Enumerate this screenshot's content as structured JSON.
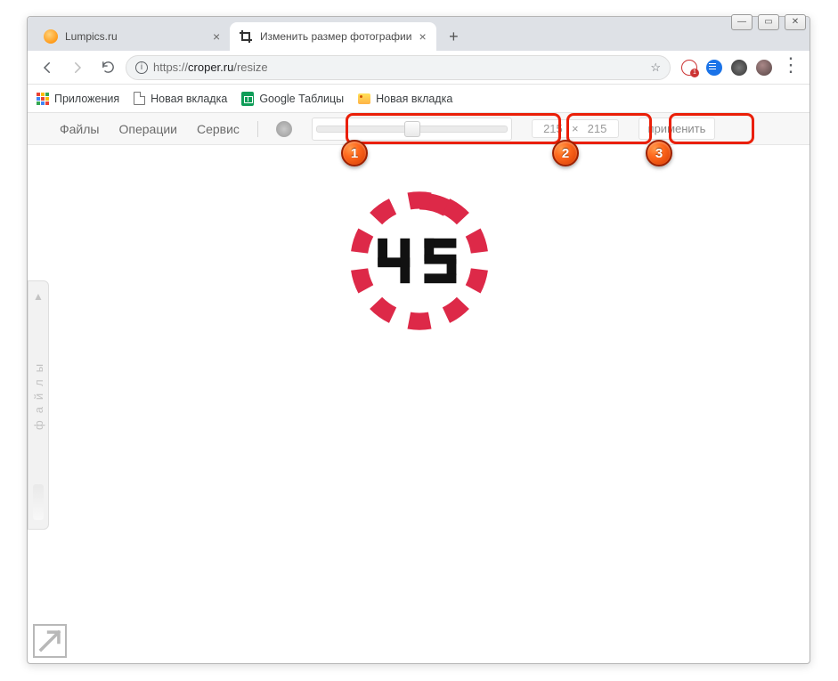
{
  "window": {
    "minimize": "—",
    "maximize": "▭",
    "close": "✕"
  },
  "tabs": [
    {
      "title": "Lumpics.ru",
      "active": false
    },
    {
      "title": "Изменить размер фотографии",
      "active": true
    }
  ],
  "omnibar": {
    "protocol": "https://",
    "host": "croper.ru",
    "path": "/resize"
  },
  "bookmarks": [
    {
      "label": "Приложения",
      "icon": "apps"
    },
    {
      "label": "Новая вкладка",
      "icon": "doc"
    },
    {
      "label": "Google Таблицы",
      "icon": "gsheet"
    },
    {
      "label": "Новая вкладка",
      "icon": "yphoto"
    }
  ],
  "toolbar": {
    "menu": [
      "Файлы",
      "Операции",
      "Сервис"
    ],
    "width": "215",
    "times": "×",
    "height": "215",
    "apply": "применить"
  },
  "side_tab_label": "файлы",
  "callouts": [
    "1",
    "2",
    "3"
  ],
  "image_digits": "45"
}
